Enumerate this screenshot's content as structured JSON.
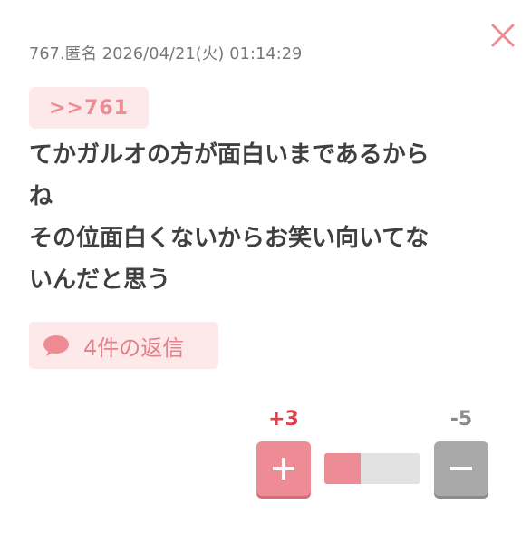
{
  "post": {
    "meta": "767.匿名 2026/04/21(火) 01:14:29",
    "anchor": ">>761",
    "body_lines": [
      "てかガルオの方が面白いまであるから",
      "ね",
      "その位面白くないからお笑い向いてな",
      "いんだと思う"
    ]
  },
  "replies": {
    "label": "4件の返信",
    "icon": "speech-bubble-icon"
  },
  "votes": {
    "plus_count": "+3",
    "minus_count": "-5",
    "plus_icon": "plus-icon",
    "minus_icon": "minus-icon",
    "plus_ratio": 0.375
  },
  "colors": {
    "accent": "#ee8c95",
    "plus_text": "#e0404c",
    "minus_bg": "#a9a9a9",
    "tag_bg": "#fde9ea"
  },
  "close": {
    "icon": "close-icon"
  }
}
